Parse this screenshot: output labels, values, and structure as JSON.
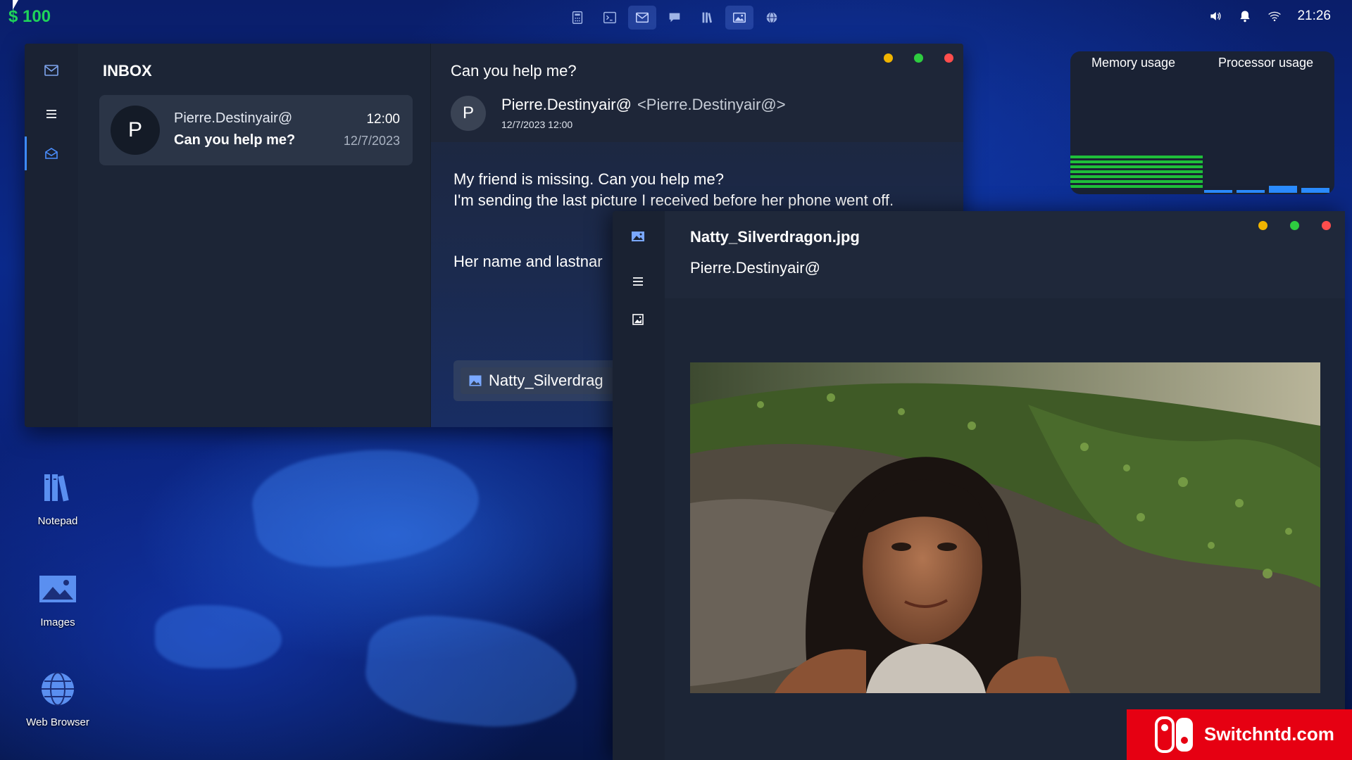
{
  "top_bar": {
    "money": "$ 100",
    "clock": "21:26",
    "taskbar_icons": [
      "calculator-icon",
      "terminal-icon",
      "email-icon",
      "chat-icon",
      "notepad-icon",
      "images-icon",
      "web-browser-icon"
    ],
    "active_tasks": [
      "email-icon",
      "images-icon"
    ],
    "tray_icons": [
      "volume-icon",
      "bell-icon",
      "wifi-icon"
    ]
  },
  "desktop": {
    "icons": [
      {
        "label": "Notepad",
        "icon": "notepad-icon"
      },
      {
        "label": "Images",
        "icon": "images-icon"
      },
      {
        "label": "Web Browser",
        "icon": "globe-icon"
      }
    ]
  },
  "email_window": {
    "inbox_title": "INBOX",
    "messages": [
      {
        "avatar": "P",
        "from": "Pierre.Destinyair@",
        "subject": "Can you help me?",
        "time": "12:00",
        "date": "12/7/2023"
      }
    ],
    "reader": {
      "subject": "Can you help me?",
      "avatar": "P",
      "from_name": "Pierre.Destinyair@",
      "from_address": "<Pierre.Destinyair@>",
      "date": "12/7/2023 12:00",
      "body_line1": "My friend is missing. Can you help me?",
      "body_line2": "I'm sending the last picture I received before her phone went off.",
      "body_line3": "Her name and lastnar",
      "attachment": "Natty_Silverdrag"
    }
  },
  "system_monitor": {
    "memory_label": "Memory usage",
    "processor_label": "Processor usage",
    "memory_level": 0.32,
    "processor_level": 0.08
  },
  "image_viewer": {
    "file_name": "Natty_Silverdragon.jpg",
    "sender": "Pierre.Destinyair@"
  },
  "watermark": {
    "text": "Switchntd.com"
  },
  "colors": {
    "money": "#1fd35a",
    "accent": "#3d8bff",
    "dot_yellow": "#f0b400",
    "dot_green": "#2ecc40",
    "dot_red": "#ff4d4d",
    "memory_bar": "#1fbf3a",
    "processor_bar": "#2b8cff",
    "watermark": "#e60012"
  }
}
